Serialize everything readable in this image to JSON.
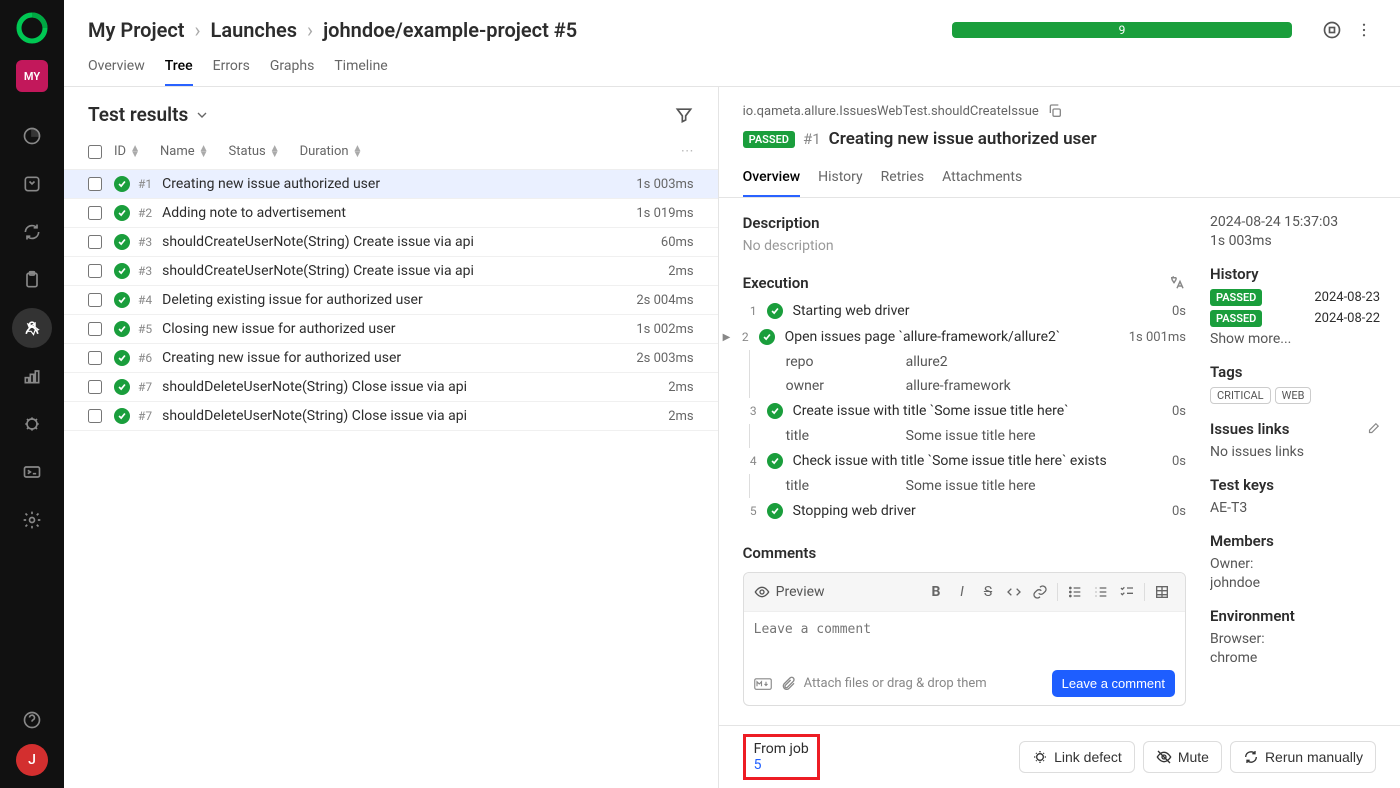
{
  "sidebar": {
    "project_badge": "MY",
    "avatar": "J"
  },
  "breadcrumb": {
    "project": "My Project",
    "section": "Launches",
    "launch": "johndoe/example-project #5"
  },
  "progress": {
    "count": "9"
  },
  "tabs": [
    "Overview",
    "Tree",
    "Errors",
    "Graphs",
    "Timeline"
  ],
  "left": {
    "title": "Test results",
    "columns": {
      "id": "ID",
      "name": "Name",
      "status": "Status",
      "duration": "Duration"
    }
  },
  "tests": [
    {
      "id": "#1",
      "name": "Creating new issue authorized user",
      "duration": "1s 003ms",
      "selected": true
    },
    {
      "id": "#2",
      "name": "Adding note to advertisement",
      "duration": "1s 019ms"
    },
    {
      "id": "#3",
      "name": "shouldCreateUserNote(String) Create issue via api",
      "duration": "60ms"
    },
    {
      "id": "#3",
      "name": "shouldCreateUserNote(String) Create issue via api",
      "duration": "2ms"
    },
    {
      "id": "#4",
      "name": "Deleting existing issue for authorized user",
      "duration": "2s 004ms"
    },
    {
      "id": "#5",
      "name": "Closing new issue for authorized user",
      "duration": "1s 002ms"
    },
    {
      "id": "#6",
      "name": "Creating new issue for authorized user",
      "duration": "2s 003ms"
    },
    {
      "id": "#7",
      "name": "shouldDeleteUserNote(String) Close issue via api",
      "duration": "2ms"
    },
    {
      "id": "#7",
      "name": "shouldDeleteUserNote(String) Close issue via api",
      "duration": "2ms"
    }
  ],
  "detail": {
    "path": "io.qameta.allure.IssuesWebTest.shouldCreateIssue",
    "status": "PASSED",
    "num": "#1",
    "title": "Creating new issue authorized user",
    "tabs": [
      "Overview",
      "History",
      "Retries",
      "Attachments"
    ],
    "description_label": "Description",
    "no_description": "No description",
    "execution_label": "Execution",
    "steps": [
      {
        "n": "1",
        "label": "Starting web driver",
        "dur": "0s"
      },
      {
        "n": "2",
        "label": "Open issues page `allure-framework/allure2`",
        "dur": "1s 001ms",
        "expandable": true,
        "params": [
          {
            "name": "repo",
            "value": "allure2"
          },
          {
            "name": "owner",
            "value": "allure-framework"
          }
        ]
      },
      {
        "n": "3",
        "label": "Create issue with title `Some issue title here`",
        "dur": "0s",
        "params": [
          {
            "name": "title",
            "value": "Some issue title here"
          }
        ]
      },
      {
        "n": "4",
        "label": "Check issue with title `Some issue title here` exists",
        "dur": "0s",
        "params": [
          {
            "name": "title",
            "value": "Some issue title here"
          }
        ]
      },
      {
        "n": "5",
        "label": "Stopping web driver",
        "dur": "0s"
      }
    ],
    "comments_label": "Comments",
    "preview_label": "Preview",
    "comment_placeholder": "Leave a comment",
    "attach_label": "Attach files or drag & drop them",
    "leave_comment_btn": "Leave a comment"
  },
  "side": {
    "timestamp": "2024-08-24 15:37:03",
    "duration": "1s 003ms",
    "history_label": "History",
    "history": [
      {
        "status": "PASSED",
        "date": "2024-08-23"
      },
      {
        "status": "PASSED",
        "date": "2024-08-22"
      }
    ],
    "show_more": "Show more...",
    "tags_label": "Tags",
    "tags": [
      "CRITICAL",
      "WEB"
    ],
    "issues_label": "Issues links",
    "no_issues": "No issues links",
    "testkeys_label": "Test keys",
    "testkeys": "AE-T3",
    "members_label": "Members",
    "owner_label": "Owner:",
    "owner_value": "johndoe",
    "env_label": "Environment",
    "browser_label": "Browser:",
    "browser_value": "chrome"
  },
  "footer": {
    "from_job": "From job",
    "job_num": "5",
    "link_defect": "Link defect",
    "mute": "Mute",
    "rerun": "Rerun manually"
  }
}
